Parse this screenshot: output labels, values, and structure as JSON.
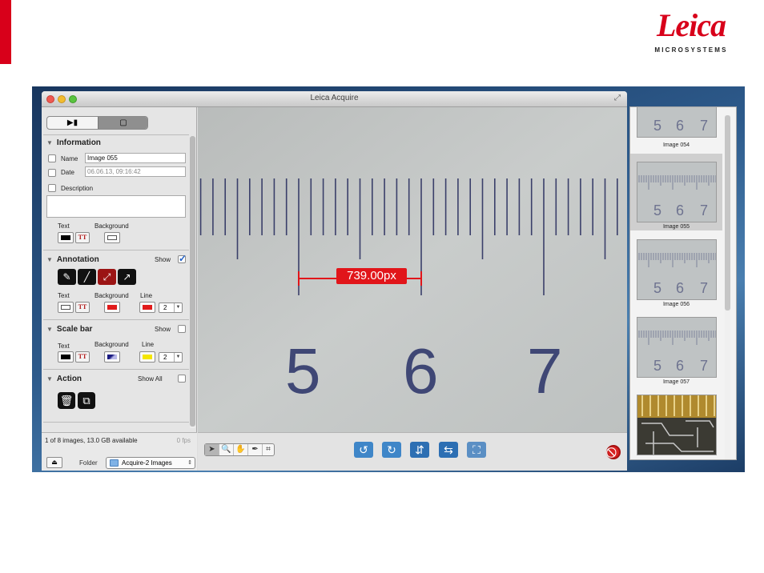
{
  "brand": {
    "name": "Leica",
    "tagline": "MICROSYSTEMS",
    "accent": "#d8001a"
  },
  "window": {
    "title": "Leica Acquire"
  },
  "information": {
    "header": "Information",
    "name_label": "Name",
    "name_value": "Image 055",
    "date_label": "Date",
    "date_value": "06.06.13, 09:16:42",
    "description_label": "Description",
    "text_label": "Text",
    "background_label": "Background"
  },
  "annotation": {
    "header": "Annotation",
    "show_label": "Show",
    "show_checked": true,
    "tools": [
      "pencil-icon",
      "line-icon",
      "measure-line-icon",
      "arrow-icon"
    ],
    "text_label": "Text",
    "background_label": "Background",
    "line_label": "Line",
    "line_width": "2"
  },
  "scalebar": {
    "header": "Scale bar",
    "show_label": "Show",
    "text_label": "Text",
    "background_label": "Background",
    "line_label": "Line",
    "line_width": "2"
  },
  "action": {
    "header": "Action",
    "show_all_label": "Show All"
  },
  "footer": {
    "status": "1 of 8 images, 13.0 GB available",
    "fps": "0 fps",
    "folder_label": "Folder",
    "folder_value": "Acquire-2 Images"
  },
  "viewer": {
    "measurement": "739.00px",
    "scale_numbers": [
      "5",
      "6",
      "7"
    ]
  },
  "thumbnails": [
    {
      "caption": "Image 054",
      "selected": false
    },
    {
      "caption": "Image 055",
      "selected": true
    },
    {
      "caption": "Image 056",
      "selected": false
    },
    {
      "caption": "Image 057",
      "selected": false
    }
  ],
  "colors": {
    "measure_red": "#e1151a",
    "annotation_red": "#e11a1a",
    "scalebar_yellow": "#f4e600"
  }
}
